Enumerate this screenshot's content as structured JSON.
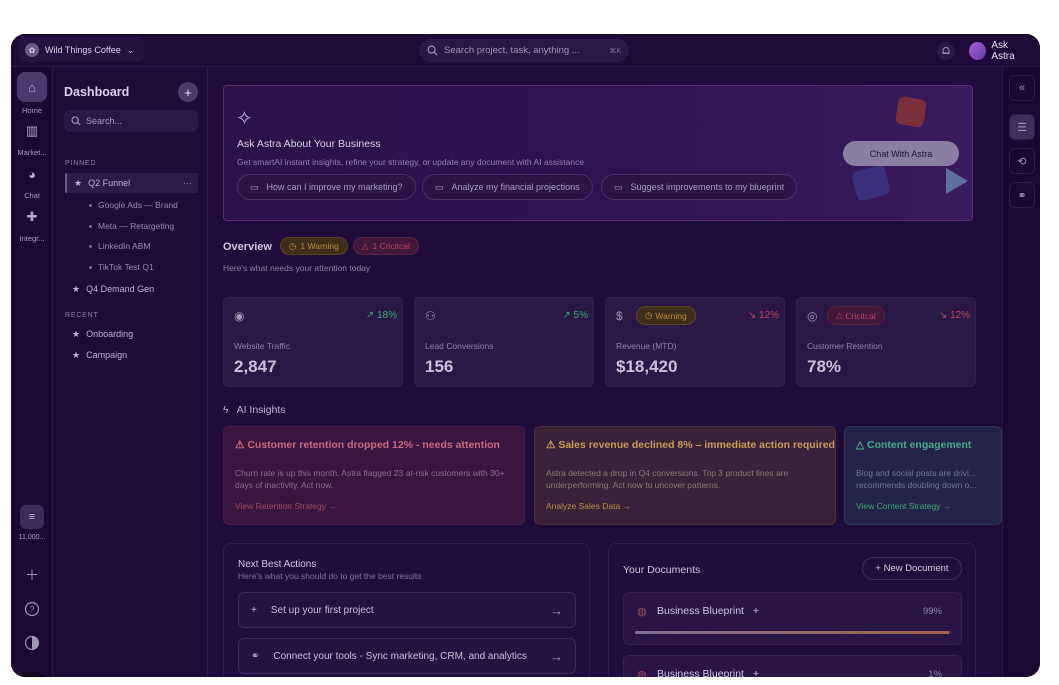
{
  "topbar": {
    "workspace": "Wild Things Coffee",
    "search_placeholder": "Search project, task, anything ...",
    "search_shortcut": "⌘K",
    "ask_astra": "Ask Astra"
  },
  "rail": {
    "items": [
      {
        "label": "Home",
        "icon": "home-icon"
      },
      {
        "label": "Market...",
        "icon": "chart-icon"
      },
      {
        "label": "Chat",
        "icon": "chat-icon"
      },
      {
        "label": "Integr...",
        "icon": "puzzle-icon"
      }
    ],
    "credits": "11,000...",
    "avatar_initials": "JD"
  },
  "panel": {
    "title": "Dashboard",
    "search_placeholder": "Search...",
    "pinned_label": "PINNED",
    "pinned": [
      {
        "label": "Q2 Funnel",
        "children": [
          "Google Ads — Brand",
          "Meta — Retargeting",
          "LinkedIn ABM",
          "TikTok Test Q1"
        ]
      },
      {
        "label": "Q4 Demand Gen"
      }
    ],
    "recent_label": "RECENT",
    "recent": [
      "Onboarding",
      "Campaign"
    ]
  },
  "hero": {
    "title": "Ask Astra About Your Business",
    "subtitle": "Get smartAI instant insights, refine your strategy, or update any document with AI assistance",
    "prompts": [
      "How can I improve my marketing?",
      "Analyze my financial projections",
      "Suggest improvements to my blueprint"
    ],
    "cta": "Chat With Astra"
  },
  "overview": {
    "title": "Overview",
    "warning_badge": "1 Warning",
    "critical_badge": "1 Cricitcal",
    "subtitle": "Here's what needs your attention today"
  },
  "metrics": [
    {
      "label": "Website Traffic",
      "value": "2,847",
      "delta": "18%",
      "trend": "up",
      "badge": ""
    },
    {
      "label": "Lead Conversions",
      "value": "156",
      "delta": "5%",
      "trend": "up",
      "badge": ""
    },
    {
      "label": "Revenue (MTD)",
      "value": "$18,420",
      "delta": "12%",
      "trend": "down",
      "badge": "Warning"
    },
    {
      "label": "Customer Retention",
      "value": "78%",
      "delta": "12%",
      "trend": "down",
      "badge": "Cricitcal"
    }
  ],
  "insights": {
    "title": "AI Insights",
    "cards": [
      {
        "title": "Customer retention dropped 12% - needs attention",
        "desc": "Churn rate is up this month. Astra flagged 23 at-risk customers with 30+ days of inactivity. Act now.",
        "link": "View Retention Strategy"
      },
      {
        "title": "Sales revenue declined 8% – immediate action required",
        "desc": "Astra detected a drop in Q4 conversions. Top 3 product lines are underperforming. Act now to uncover patterns.",
        "link": "Analyze Sales Data"
      },
      {
        "title": "Content engagement",
        "desc": "Blog and social posts are drivi... recommends doubling down o...",
        "link": "View Content Strategy"
      }
    ]
  },
  "next_actions": {
    "title": "Next Best Actions",
    "subtitle": "Here's what you should do to get the best results",
    "items": [
      "Set up your first project",
      "Connect your tools - Sync marketing, CRM, and analytics"
    ]
  },
  "documents": {
    "title": "Your Documents",
    "new_button": "+ New Document",
    "items": [
      {
        "name": "Business Blueprint",
        "percent": "99%",
        "progress": 0.99
      },
      {
        "name": "Business Blueprint",
        "percent": "1%",
        "progress": 0.01
      }
    ]
  },
  "colors": {
    "background": "#1e0d3a",
    "accent_warning": "#b98e3c",
    "accent_critical": "#b8485b",
    "accent_positive": "#3aa56e"
  }
}
